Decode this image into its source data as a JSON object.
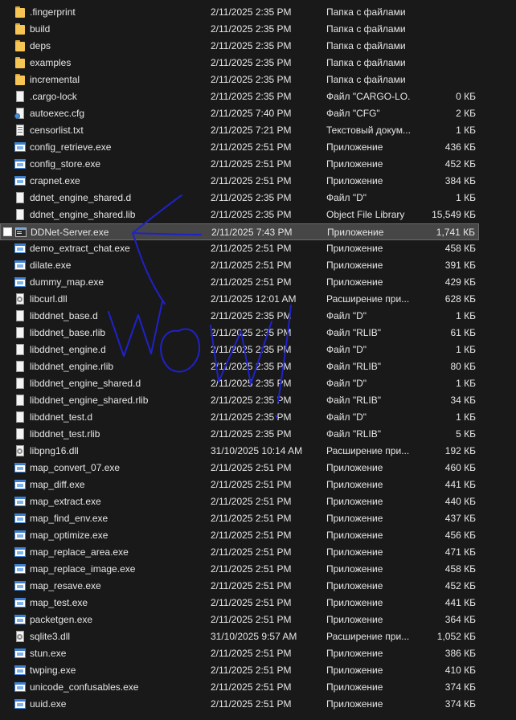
{
  "colors": {
    "background": "#191919",
    "text": "#e6e6e6",
    "selection": "#464646",
    "annotation": "#1f22c8"
  },
  "files": [
    {
      "name": ".fingerprint",
      "date": "2/11/2025 2:35 PM",
      "type": "Папка с файлами",
      "size": "",
      "icon": "folder-icon"
    },
    {
      "name": "build",
      "date": "2/11/2025 2:35 PM",
      "type": "Папка с файлами",
      "size": "",
      "icon": "folder-icon"
    },
    {
      "name": "deps",
      "date": "2/11/2025 2:35 PM",
      "type": "Папка с файлами",
      "size": "",
      "icon": "folder-icon"
    },
    {
      "name": "examples",
      "date": "2/11/2025 2:35 PM",
      "type": "Папка с файлами",
      "size": "",
      "icon": "folder-icon"
    },
    {
      "name": "incremental",
      "date": "2/11/2025 2:35 PM",
      "type": "Папка с файлами",
      "size": "",
      "icon": "folder-icon"
    },
    {
      "name": ".cargo-lock",
      "date": "2/11/2025 2:35 PM",
      "type": "Файл \"CARGO-LO...",
      "size": "0 КБ",
      "icon": "file-icon"
    },
    {
      "name": "autoexec.cfg",
      "date": "2/11/2025 7:40 PM",
      "type": "Файл \"CFG\"",
      "size": "2 КБ",
      "icon": "config-file-icon"
    },
    {
      "name": "censorlist.txt",
      "date": "2/11/2025 7:21 PM",
      "type": "Текстовый докум...",
      "size": "1 КБ",
      "icon": "text-file-icon"
    },
    {
      "name": "config_retrieve.exe",
      "date": "2/11/2025 2:51 PM",
      "type": "Приложение",
      "size": "436 КБ",
      "icon": "exe-icon"
    },
    {
      "name": "config_store.exe",
      "date": "2/11/2025 2:51 PM",
      "type": "Приложение",
      "size": "452 КБ",
      "icon": "exe-icon"
    },
    {
      "name": "crapnet.exe",
      "date": "2/11/2025 2:51 PM",
      "type": "Приложение",
      "size": "384 КБ",
      "icon": "exe-icon"
    },
    {
      "name": "ddnet_engine_shared.d",
      "date": "2/11/2025 2:35 PM",
      "type": "Файл \"D\"",
      "size": "1 КБ",
      "icon": "file-icon"
    },
    {
      "name": "ddnet_engine_shared.lib",
      "date": "2/11/2025 2:35 PM",
      "type": "Object File Library",
      "size": "15,549 КБ",
      "icon": "file-icon"
    },
    {
      "name": "DDNet-Server.exe",
      "date": "2/11/2025 7:43 PM",
      "type": "Приложение",
      "size": "1,741 КБ",
      "icon": "console-app-icon",
      "selected": true
    },
    {
      "name": "demo_extract_chat.exe",
      "date": "2/11/2025 2:51 PM",
      "type": "Приложение",
      "size": "458 КБ",
      "icon": "exe-icon"
    },
    {
      "name": "dilate.exe",
      "date": "2/11/2025 2:51 PM",
      "type": "Приложение",
      "size": "391 КБ",
      "icon": "exe-icon"
    },
    {
      "name": "dummy_map.exe",
      "date": "2/11/2025 2:51 PM",
      "type": "Приложение",
      "size": "429 КБ",
      "icon": "exe-icon"
    },
    {
      "name": "libcurl.dll",
      "date": "2/11/2025 12:01 AM",
      "type": "Расширение при...",
      "size": "628 КБ",
      "icon": "dll-icon"
    },
    {
      "name": "libddnet_base.d",
      "date": "2/11/2025 2:35 PM",
      "type": "Файл \"D\"",
      "size": "1 КБ",
      "icon": "file-icon"
    },
    {
      "name": "libddnet_base.rlib",
      "date": "2/11/2025 2:35 PM",
      "type": "Файл \"RLIB\"",
      "size": "61 КБ",
      "icon": "file-icon"
    },
    {
      "name": "libddnet_engine.d",
      "date": "2/11/2025 2:35 PM",
      "type": "Файл \"D\"",
      "size": "1 КБ",
      "icon": "file-icon"
    },
    {
      "name": "libddnet_engine.rlib",
      "date": "2/11/2025 2:35 PM",
      "type": "Файл \"RLIB\"",
      "size": "80 КБ",
      "icon": "file-icon"
    },
    {
      "name": "libddnet_engine_shared.d",
      "date": "2/11/2025 2:35 PM",
      "type": "Файл \"D\"",
      "size": "1 КБ",
      "icon": "file-icon"
    },
    {
      "name": "libddnet_engine_shared.rlib",
      "date": "2/11/2025 2:35 PM",
      "type": "Файл \"RLIB\"",
      "size": "34 КБ",
      "icon": "file-icon"
    },
    {
      "name": "libddnet_test.d",
      "date": "2/11/2025 2:35 PM",
      "type": "Файл \"D\"",
      "size": "1 КБ",
      "icon": "file-icon"
    },
    {
      "name": "libddnet_test.rlib",
      "date": "2/11/2025 2:35 PM",
      "type": "Файл \"RLIB\"",
      "size": "5 КБ",
      "icon": "file-icon"
    },
    {
      "name": "libpng16.dll",
      "date": "31/10/2025 10:14 AM",
      "type": "Расширение при...",
      "size": "192 КБ",
      "icon": "dll-icon"
    },
    {
      "name": "map_convert_07.exe",
      "date": "2/11/2025 2:51 PM",
      "type": "Приложение",
      "size": "460 КБ",
      "icon": "exe-icon"
    },
    {
      "name": "map_diff.exe",
      "date": "2/11/2025 2:51 PM",
      "type": "Приложение",
      "size": "441 КБ",
      "icon": "exe-icon"
    },
    {
      "name": "map_extract.exe",
      "date": "2/11/2025 2:51 PM",
      "type": "Приложение",
      "size": "440 КБ",
      "icon": "exe-icon"
    },
    {
      "name": "map_find_env.exe",
      "date": "2/11/2025 2:51 PM",
      "type": "Приложение",
      "size": "437 КБ",
      "icon": "exe-icon"
    },
    {
      "name": "map_optimize.exe",
      "date": "2/11/2025 2:51 PM",
      "type": "Приложение",
      "size": "456 КБ",
      "icon": "exe-icon"
    },
    {
      "name": "map_replace_area.exe",
      "date": "2/11/2025 2:51 PM",
      "type": "Приложение",
      "size": "471 КБ",
      "icon": "exe-icon"
    },
    {
      "name": "map_replace_image.exe",
      "date": "2/11/2025 2:51 PM",
      "type": "Приложение",
      "size": "458 КБ",
      "icon": "exe-icon"
    },
    {
      "name": "map_resave.exe",
      "date": "2/11/2025 2:51 PM",
      "type": "Приложение",
      "size": "452 КБ",
      "icon": "exe-icon"
    },
    {
      "name": "map_test.exe",
      "date": "2/11/2025 2:51 PM",
      "type": "Приложение",
      "size": "441 КБ",
      "icon": "exe-icon"
    },
    {
      "name": "packetgen.exe",
      "date": "2/11/2025 2:51 PM",
      "type": "Приложение",
      "size": "364 КБ",
      "icon": "exe-icon"
    },
    {
      "name": "sqlite3.dll",
      "date": "31/10/2025 9:57 AM",
      "type": "Расширение при...",
      "size": "1,052 КБ",
      "icon": "dll-icon"
    },
    {
      "name": "stun.exe",
      "date": "2/11/2025 2:51 PM",
      "type": "Приложение",
      "size": "386 КБ",
      "icon": "exe-icon"
    },
    {
      "name": "twping.exe",
      "date": "2/11/2025 2:51 PM",
      "type": "Приложение",
      "size": "410 КБ",
      "icon": "exe-icon"
    },
    {
      "name": "unicode_confusables.exe",
      "date": "2/11/2025 2:51 PM",
      "type": "Приложение",
      "size": "374 КБ",
      "icon": "exe-icon"
    },
    {
      "name": "uuid.exe",
      "date": "2/11/2025 2:51 PM",
      "type": "Приложение",
      "size": "374 КБ",
      "icon": "exe-icon"
    }
  ]
}
